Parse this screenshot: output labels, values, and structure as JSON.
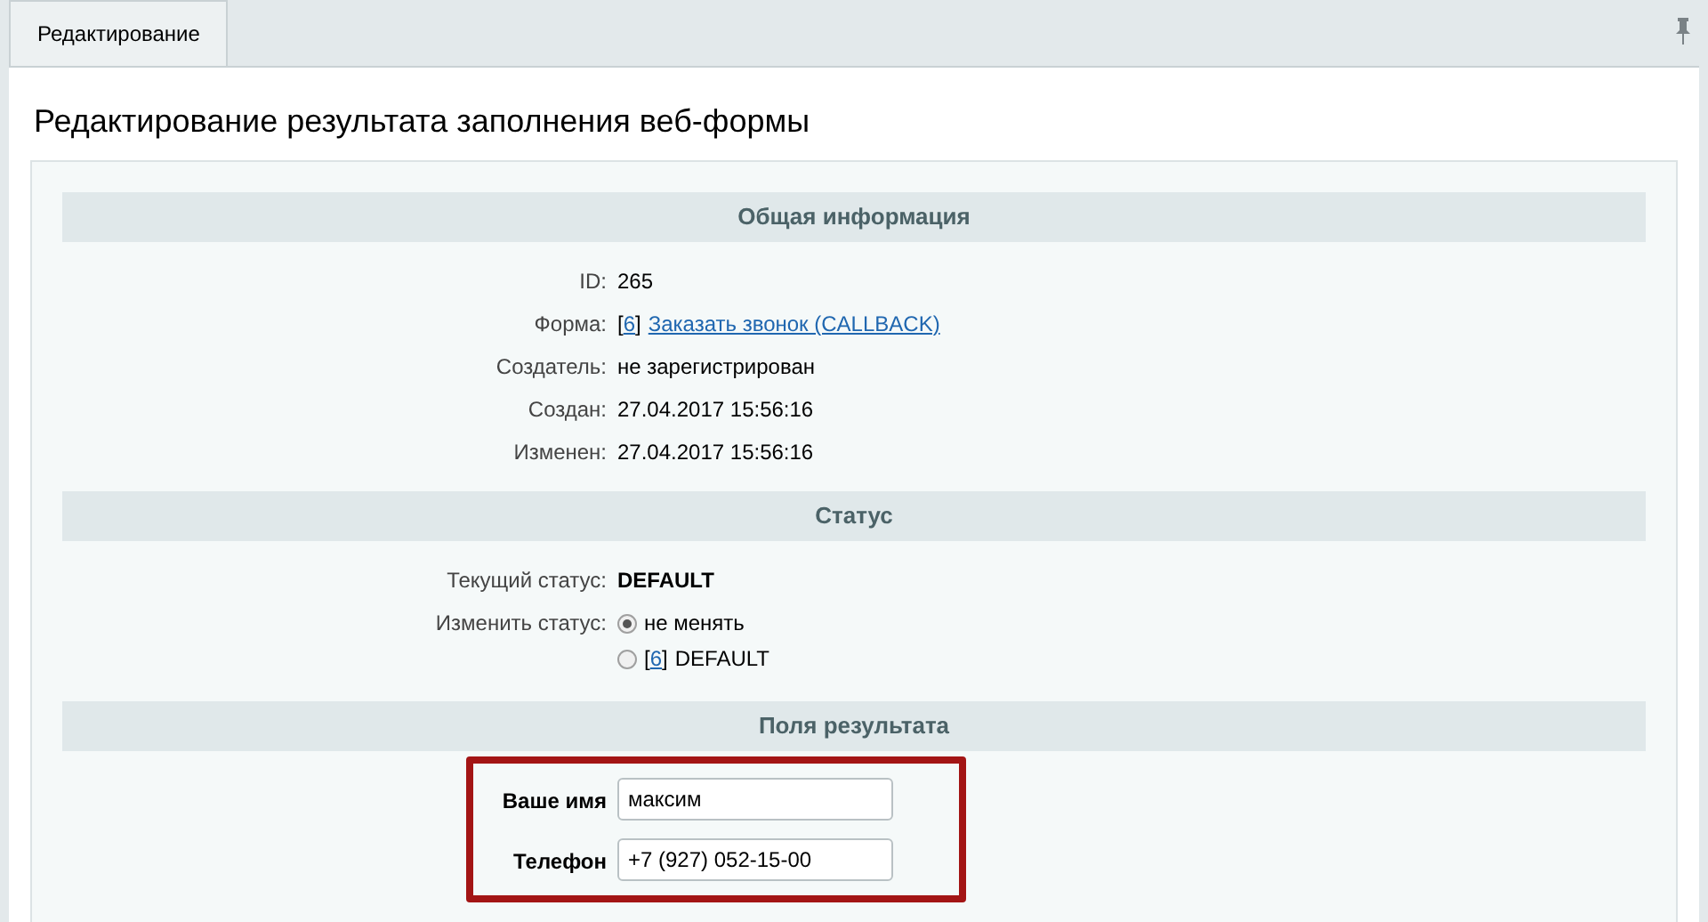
{
  "tabs": [
    {
      "label": "Редактирование",
      "selected": true
    }
  ],
  "title": "Редактирование результата заполнения веб-формы",
  "sections": [
    {
      "heading": "Общая информация",
      "rows": [
        {
          "kind": "text",
          "label": "ID:",
          "value": "265"
        },
        {
          "kind": "link",
          "label": "Форма:",
          "open": "[",
          "ref": "6",
          "close": "]",
          "link": "Заказать звонок (CALLBACK)"
        },
        {
          "kind": "text",
          "label": "Создатель:",
          "value": "не зарегистрирован"
        },
        {
          "kind": "text",
          "label": "Создан:",
          "value": "27.04.2017 15:56:16"
        },
        {
          "kind": "text",
          "label": "Изменен:",
          "value": "27.04.2017 15:56:16"
        }
      ]
    },
    {
      "heading": "Статус",
      "rows": [
        {
          "kind": "bold",
          "label": "Текущий статус:",
          "value": "DEFAULT"
        },
        {
          "kind": "radios",
          "label": "Изменить статус:",
          "options": [
            {
              "text": "не менять",
              "selected": true
            },
            {
              "open": "[",
              "ref": "6",
              "close": "]",
              "text": "DEFAULT",
              "selected": false
            }
          ]
        }
      ]
    },
    {
      "heading": "Поля результата",
      "highlighted": true,
      "rows": [
        {
          "kind": "input",
          "label": "Ваше имя",
          "value": "максим"
        },
        {
          "kind": "input",
          "label": "Телефон",
          "value": "+7 (927) 052-15-00"
        }
      ]
    }
  ]
}
